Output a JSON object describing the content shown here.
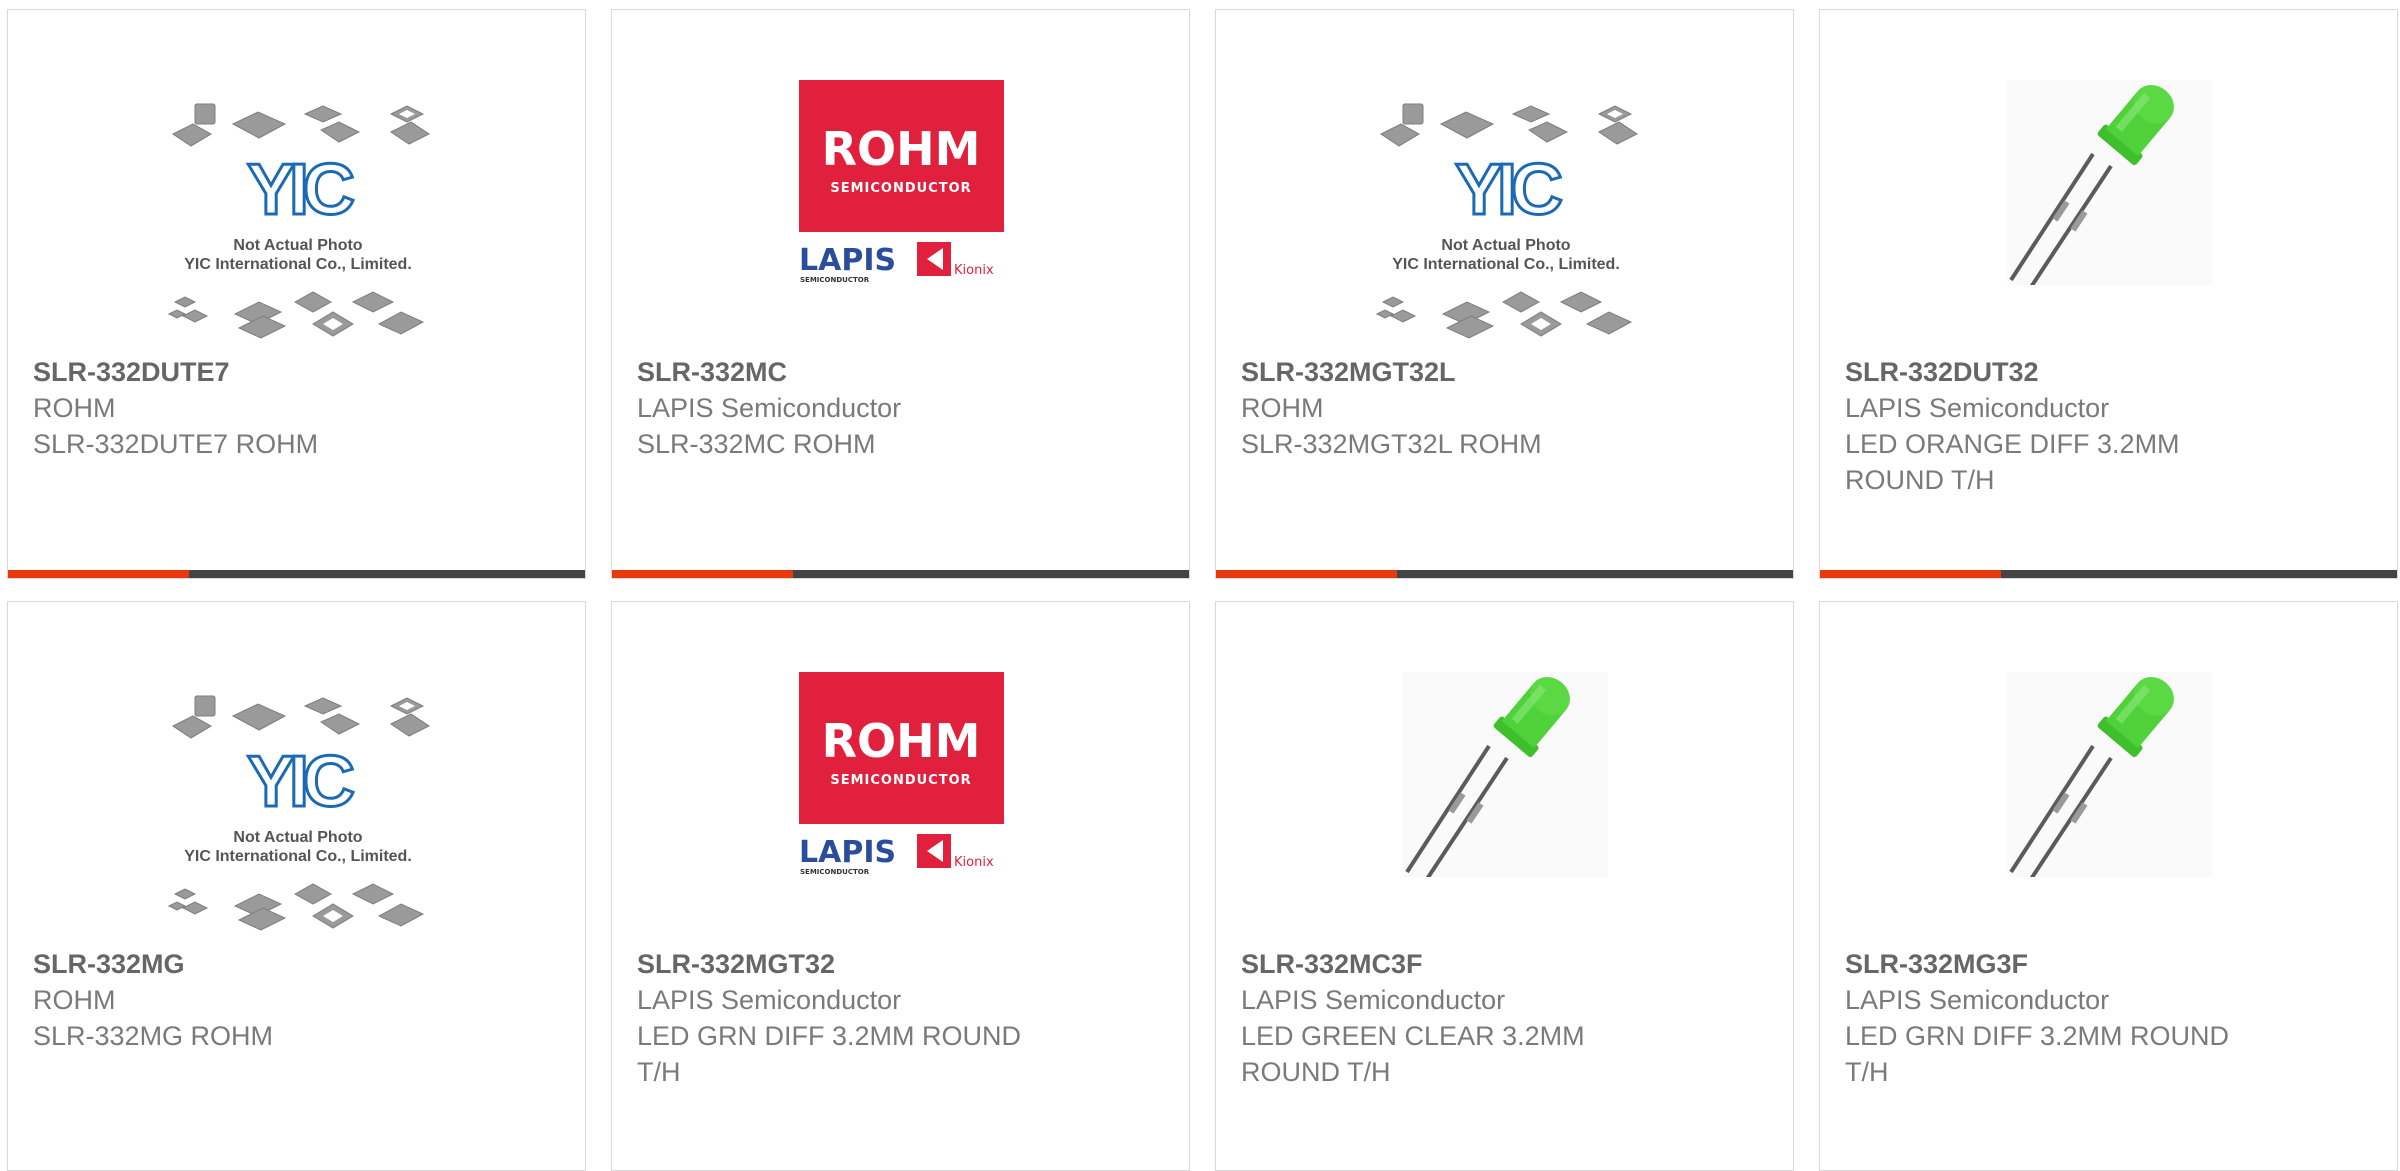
{
  "theme": {
    "accent_color": "#e8380d",
    "bar_color": "#444444",
    "rohm_red": "#e0203c",
    "lapis_blue": "#2a4e9c",
    "yic_blue": "#1c6ab4"
  },
  "image_text": {
    "not_actual_photo": "Not Actual Photo",
    "company": "YIC International Co., Limited.",
    "yic_logo": "YIC",
    "rohm_logo": "ROHM",
    "rohm_sub": "SEMICONDUCTOR",
    "lapis_logo": "LAPIS",
    "lapis_sub": "SEMICONDUCTOR",
    "kionix_logo": "Kionix"
  },
  "products": [
    {
      "image": "yic-placeholder",
      "part_number": "SLR-332DUTE7",
      "manufacturer": "ROHM",
      "desc_lines": [
        "SLR-332DUTE7 ROHM"
      ],
      "has_bar": true
    },
    {
      "image": "rohm-lapis-logo",
      "part_number": "SLR-332MC",
      "manufacturer": "LAPIS Semiconductor",
      "desc_lines": [
        "SLR-332MC ROHM"
      ],
      "has_bar": true
    },
    {
      "image": "yic-placeholder",
      "part_number": "SLR-332MGT32L",
      "manufacturer": "ROHM",
      "desc_lines": [
        "SLR-332MGT32L ROHM"
      ],
      "has_bar": true
    },
    {
      "image": "green-led",
      "part_number": "SLR-332DUT32",
      "manufacturer": "LAPIS Semiconductor",
      "desc_lines": [
        "LED ORANGE DIFF 3.2MM",
        "ROUND T/H"
      ],
      "has_bar": true
    },
    {
      "image": "yic-placeholder",
      "part_number": "SLR-332MG",
      "manufacturer": "ROHM",
      "desc_lines": [
        "SLR-332MG ROHM"
      ],
      "has_bar": false
    },
    {
      "image": "rohm-lapis-logo",
      "part_number": "SLR-332MGT32",
      "manufacturer": "LAPIS Semiconductor",
      "desc_lines": [
        "LED GRN DIFF 3.2MM ROUND",
        "T/H"
      ],
      "has_bar": false
    },
    {
      "image": "green-led",
      "part_number": "SLR-332MC3F",
      "manufacturer": "LAPIS Semiconductor",
      "desc_lines": [
        "LED GREEN CLEAR 3.2MM",
        "ROUND T/H"
      ],
      "has_bar": false
    },
    {
      "image": "green-led",
      "part_number": "SLR-332MG3F",
      "manufacturer": "LAPIS Semiconductor",
      "desc_lines": [
        "LED GRN DIFF 3.2MM ROUND",
        "T/H"
      ],
      "has_bar": false
    }
  ]
}
